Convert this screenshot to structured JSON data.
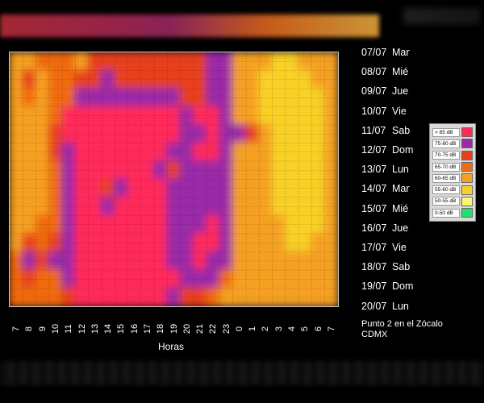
{
  "chart_data": {
    "type": "heatmap",
    "x_tick_labels": [
      "7",
      "8",
      "9",
      "10",
      "11",
      "12",
      "13",
      "14",
      "15",
      "16",
      "17",
      "18",
      "19",
      "20",
      "21",
      "22",
      "23",
      "0",
      "1",
      "2",
      "3",
      "4",
      "5",
      "6",
      "7"
    ],
    "xlabel": "Horas",
    "y_labels": [
      {
        "date": "07/07",
        "day": "Mar"
      },
      {
        "date": "08/07",
        "day": "Mié"
      },
      {
        "date": "09/07",
        "day": "Jue"
      },
      {
        "date": "10/07",
        "day": "Vie"
      },
      {
        "date": "11/07",
        "day": "Sab"
      },
      {
        "date": "12/07",
        "day": "Dom"
      },
      {
        "date": "13/07",
        "day": "Lun"
      },
      {
        "date": "14/07",
        "day": "Mar"
      },
      {
        "date": "15/07",
        "day": "Mié"
      },
      {
        "date": "16/07",
        "day": "Jue"
      },
      {
        "date": "17/07",
        "day": "Vie"
      },
      {
        "date": "18/07",
        "day": "Sab"
      },
      {
        "date": "19/07",
        "day": "Dom"
      },
      {
        "date": "20/07",
        "day": "Lun"
      }
    ],
    "legend": [
      {
        "label": "> 85 dB",
        "color": "#ff2a5a"
      },
      {
        "label": "75-80 dB",
        "color": "#9a2aa8"
      },
      {
        "label": "70-75 dB",
        "color": "#e8401a"
      },
      {
        "label": "65-70 dB",
        "color": "#f06a10"
      },
      {
        "label": "60-65 dB",
        "color": "#f5a020"
      },
      {
        "label": "55-60 dB",
        "color": "#f8d028"
      },
      {
        "label": "50-55 dB",
        "color": "#f8f870"
      },
      {
        "label": "0-50 dB",
        "color": "#20e070"
      }
    ],
    "levels": [
      [
        4,
        4,
        3,
        3,
        3,
        4,
        2,
        2,
        2,
        2,
        2,
        2,
        2,
        2,
        2,
        1,
        1,
        4,
        4,
        4,
        5,
        5,
        4,
        4,
        4
      ],
      [
        4,
        2,
        4,
        3,
        3,
        2,
        2,
        1,
        2,
        2,
        2,
        2,
        2,
        2,
        2,
        1,
        1,
        4,
        4,
        5,
        5,
        5,
        5,
        4,
        4
      ],
      [
        4,
        3,
        4,
        3,
        3,
        1,
        1,
        1,
        1,
        1,
        1,
        1,
        1,
        2,
        2,
        1,
        1,
        4,
        4,
        5,
        5,
        5,
        5,
        5,
        4
      ],
      [
        4,
        4,
        4,
        3,
        0,
        0,
        0,
        0,
        0,
        0,
        0,
        0,
        0,
        1,
        0,
        0,
        1,
        4,
        4,
        5,
        5,
        5,
        5,
        5,
        4
      ],
      [
        4,
        4,
        4,
        2,
        0,
        0,
        0,
        0,
        0,
        0,
        0,
        0,
        0,
        1,
        1,
        0,
        1,
        1,
        2,
        4,
        5,
        5,
        5,
        5,
        4
      ],
      [
        4,
        4,
        4,
        2,
        1,
        0,
        0,
        0,
        0,
        0,
        0,
        0,
        1,
        1,
        0,
        0,
        1,
        4,
        4,
        4,
        5,
        5,
        5,
        5,
        4
      ],
      [
        4,
        4,
        4,
        3,
        1,
        0,
        0,
        0,
        0,
        0,
        0,
        1,
        2,
        1,
        1,
        1,
        1,
        4,
        4,
        4,
        5,
        5,
        5,
        5,
        4
      ],
      [
        4,
        4,
        4,
        3,
        1,
        0,
        0,
        2,
        1,
        0,
        0,
        0,
        1,
        1,
        1,
        1,
        1,
        4,
        4,
        4,
        5,
        5,
        5,
        5,
        4
      ],
      [
        4,
        4,
        4,
        3,
        1,
        0,
        0,
        1,
        0,
        0,
        0,
        0,
        1,
        1,
        1,
        1,
        1,
        4,
        4,
        4,
        5,
        5,
        5,
        5,
        4
      ],
      [
        4,
        4,
        3,
        3,
        1,
        0,
        0,
        0,
        0,
        0,
        0,
        0,
        1,
        1,
        1,
        0,
        1,
        4,
        4,
        4,
        4,
        5,
        5,
        5,
        4
      ],
      [
        4,
        2,
        3,
        2,
        1,
        0,
        0,
        0,
        0,
        0,
        0,
        0,
        1,
        1,
        0,
        0,
        1,
        4,
        4,
        4,
        4,
        5,
        5,
        4,
        4
      ],
      [
        3,
        1,
        2,
        1,
        1,
        0,
        0,
        0,
        0,
        0,
        0,
        0,
        1,
        1,
        0,
        1,
        1,
        4,
        4,
        4,
        4,
        4,
        4,
        4,
        4
      ],
      [
        3,
        2,
        3,
        3,
        1,
        0,
        0,
        0,
        0,
        0,
        0,
        0,
        0,
        1,
        1,
        1,
        3,
        4,
        4,
        4,
        4,
        4,
        4,
        4,
        4
      ],
      [
        3,
        3,
        3,
        3,
        2,
        0,
        0,
        0,
        0,
        0,
        0,
        0,
        1,
        2,
        2,
        3,
        4,
        4,
        4,
        4,
        4,
        4,
        4,
        4,
        4
      ]
    ]
  },
  "caption": {
    "line1": "Punto 2 en el Zócalo",
    "line2": "CDMX"
  }
}
